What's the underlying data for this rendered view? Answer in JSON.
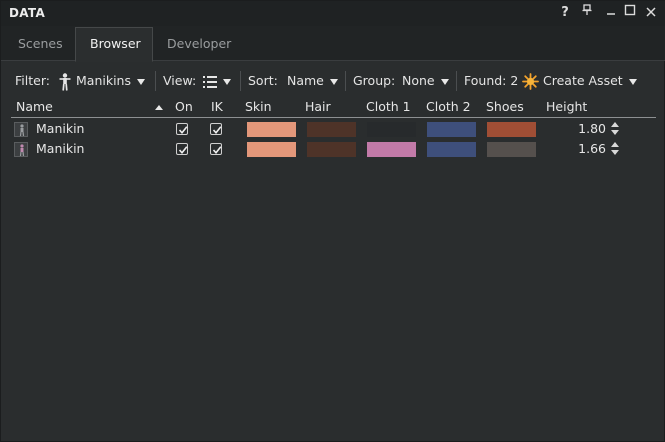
{
  "window": {
    "title": "DATA"
  },
  "titlebar": {
    "help_label": "?",
    "pin_label": "⊥",
    "minimize_label": "–",
    "maximize_label": "☐",
    "close_label": "✕"
  },
  "tabs": [
    {
      "label": "Scenes",
      "active": false
    },
    {
      "label": "Browser",
      "active": true
    },
    {
      "label": "Developer",
      "active": false
    }
  ],
  "toolbar": {
    "filter_label": "Filter:",
    "filter_value": "Manikins",
    "filter_icon": "manikin-icon",
    "view_label": "View:",
    "view_icon": "list-view-icon",
    "sort_label": "Sort:",
    "sort_value": "Name",
    "group_label": "Group:",
    "group_value": "None",
    "found_label": "Found: 2",
    "create_label": "Create Asset",
    "create_icon": "sparkle-icon"
  },
  "table": {
    "columns": [
      "Name",
      "On",
      "IK",
      "Skin",
      "Hair",
      "Cloth 1",
      "Cloth 2",
      "Shoes",
      "Height"
    ],
    "sort_direction": "ascending",
    "rows": [
      {
        "name": "Manikin",
        "on": true,
        "ik": true,
        "skin": "#e3977a",
        "hair": "#4e3328",
        "cloth1": "#272a2c",
        "cloth2": "#3e4f7b",
        "shoes": "#a04e35",
        "height": "1.80"
      },
      {
        "name": "Manikin",
        "on": true,
        "ik": true,
        "skin": "#e3977a",
        "hair": "#4e3328",
        "cloth1": "#c27aa8",
        "cloth2": "#3e4f7b",
        "shoes": "#55504d",
        "height": "1.66"
      }
    ]
  },
  "colors": {
    "accent": "#f3a22c",
    "background": "#2a2d2e",
    "titlebar": "#1f2223"
  }
}
